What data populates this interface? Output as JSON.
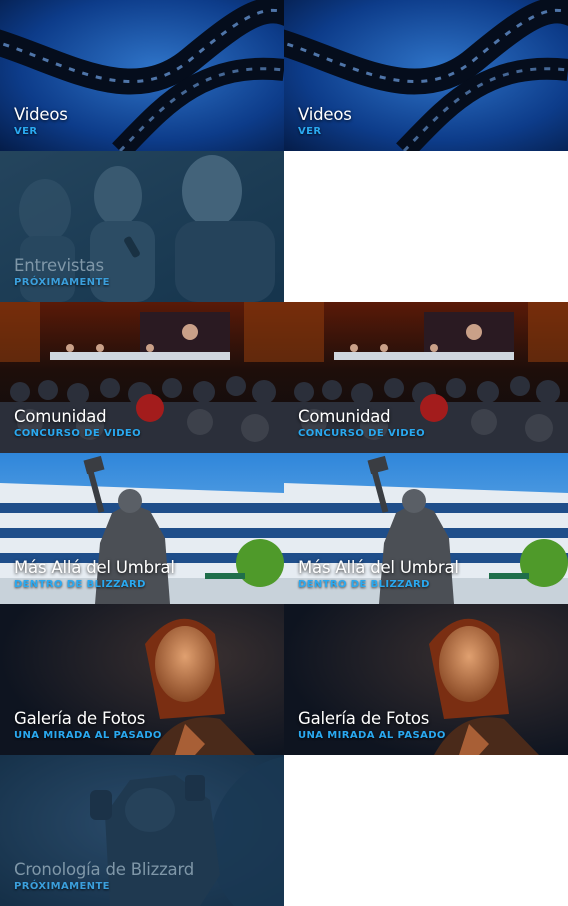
{
  "colors": {
    "title": "#ffffff",
    "subtitle_accent": "#2aa9f0",
    "coming_soon_title": "#7f97a8"
  },
  "tiles": [
    {
      "title": "Videos",
      "subtitle": "VER",
      "theme": "film"
    },
    {
      "title": "Videos",
      "subtitle": "VER",
      "theme": "film"
    },
    {
      "title": "Entrevistas",
      "subtitle": "PRÓXIMAMENTE",
      "theme": "interview",
      "coming_soon": true
    },
    {
      "title": "Comunidad",
      "subtitle": "CONCURSO DE VIDEO",
      "theme": "crowd"
    },
    {
      "title": "Comunidad",
      "subtitle": "CONCURSO DE VIDEO",
      "theme": "crowd"
    },
    {
      "title": "Más Allá del Umbral",
      "subtitle": "DENTRO DE BLIZZARD",
      "theme": "building"
    },
    {
      "title": "Más Allá del Umbral",
      "subtitle": "DENTRO DE BLIZZARD",
      "theme": "building"
    },
    {
      "title": "Galería de Fotos",
      "subtitle": "UNA MIRADA AL PASADO",
      "theme": "portrait"
    },
    {
      "title": "Galería de Fotos",
      "subtitle": "UNA MIRADA AL PASADO",
      "theme": "portrait"
    },
    {
      "title": "Cronología de Blizzard",
      "subtitle": "PRÓXIMAMENTE",
      "theme": "marine",
      "coming_soon": true
    }
  ]
}
